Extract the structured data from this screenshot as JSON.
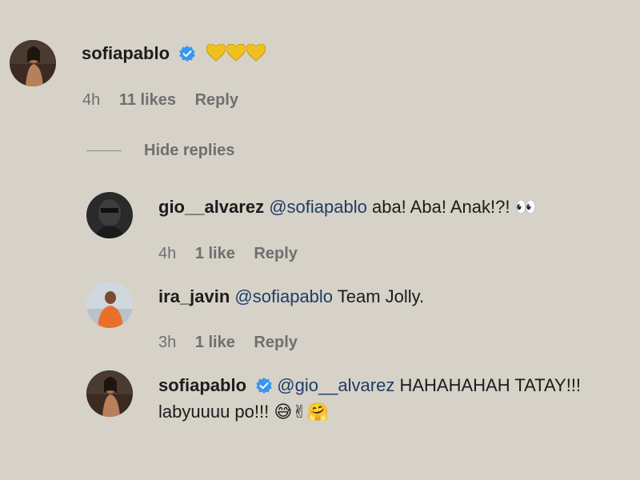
{
  "comments": [
    {
      "username": "sofiapablo",
      "verified": true,
      "mention": "",
      "text": "",
      "emoji": [
        "yellow-heart",
        "yellow-heart",
        "yellow-heart"
      ],
      "time": "4h",
      "likes": "11 likes",
      "reply": "Reply"
    }
  ],
  "replies_toggle": "Hide replies",
  "replies": [
    {
      "username": "gio__alvarez",
      "verified": false,
      "mention": "@sofiapablo",
      "text": "aba! Aba! Anak!?!",
      "emoji_text": "👀",
      "time": "4h",
      "likes": "1 like",
      "reply": "Reply"
    },
    {
      "username": "ira_javin",
      "verified": false,
      "mention": "@sofiapablo",
      "text": "Team Jolly.",
      "time": "3h",
      "likes": "1 like",
      "reply": "Reply"
    },
    {
      "username": "sofiapablo",
      "verified": true,
      "mention": "@gio__alvarez",
      "text": "HAHAHAHAH TATAY!!!",
      "text2": "labyuuuu po!!!",
      "emoji_text": "😅✌🤗"
    }
  ],
  "colors": {
    "background": "#d6d2c8",
    "verified": "#3897f0",
    "mention": "#1f3c66",
    "meta": "#6f6f6f",
    "heart": "#f0c11e"
  }
}
